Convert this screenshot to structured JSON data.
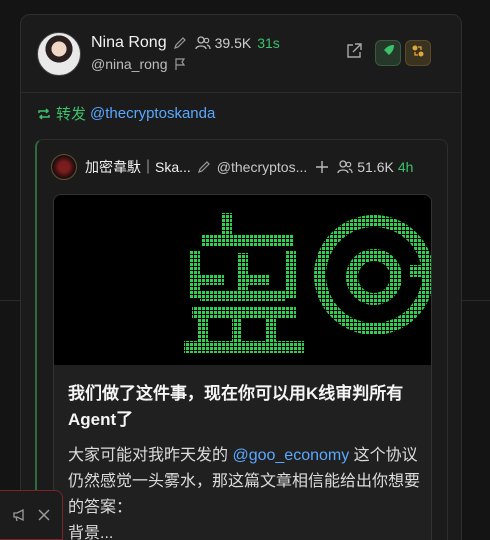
{
  "post": {
    "author": {
      "name": "Nina Rong",
      "handle": "@nina_rong",
      "followers": "39.5K",
      "time": "31s"
    },
    "repost": {
      "verb": "转发",
      "user": "@thecryptoskanda"
    },
    "quoted": {
      "name": "加密韋馱｜Ska...",
      "handle": "@thecryptos...",
      "followers": "51.6K",
      "time": "4h",
      "article": {
        "title": "我们做了这件事，现在你可以用K线审判所有Agent了",
        "body_prefix": "大家可能对我昨天发的 ",
        "mention": "@goo_economy",
        "body_suffix": " 这个协议仍然感觉一头雾水，那这篇文章相信能给出你想要的答案：",
        "body_cut": "背景..."
      }
    }
  },
  "icons": {
    "edit": "pencil-icon",
    "followers": "users-icon",
    "external": "external-link-icon",
    "rocket": "rocket-icon",
    "repost": "repost-icon"
  },
  "colors": {
    "accent_green": "#3cc16b",
    "mention_blue": "#5aa8ff",
    "banner_green": "#2fd14c"
  }
}
